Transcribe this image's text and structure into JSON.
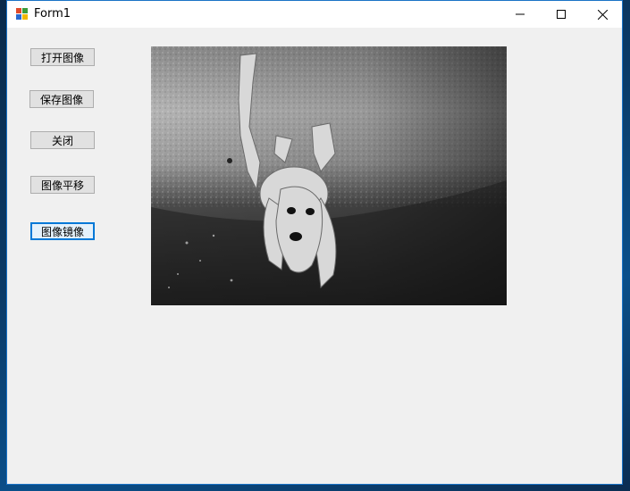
{
  "window": {
    "title": "Form1"
  },
  "buttons": {
    "open_image": "打开图像",
    "save_image": "保存图像",
    "close": "关闭",
    "translate_image": "图像平移",
    "mirror_image": "图像镜像"
  },
  "picture": {
    "description_icon": "dog-photo-mirrored-grayscale"
  },
  "colors": {
    "accent": "#0078d7",
    "window_bg": "#f0f0f0",
    "button_bg": "#e1e1e1"
  }
}
